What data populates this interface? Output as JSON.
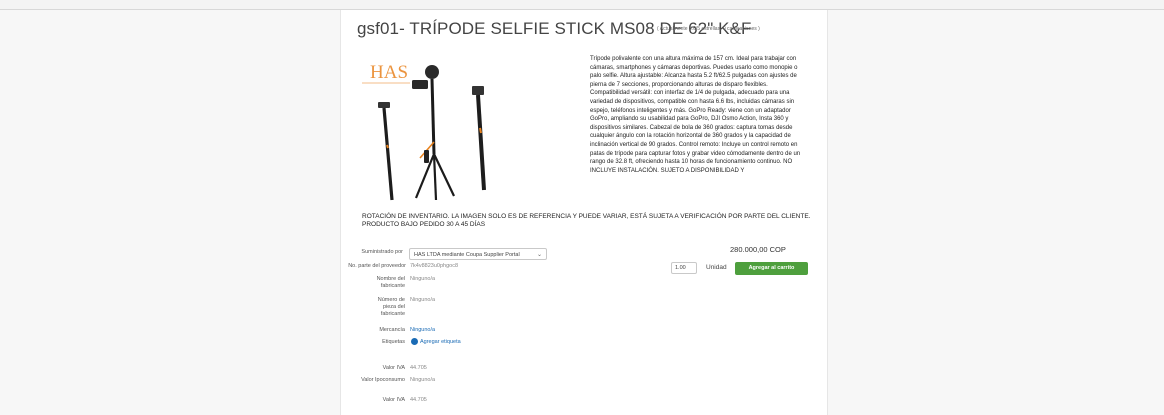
{
  "product": {
    "title": "gsf01- TRÍPODE SELFIE STICK MS08 DE 62\" K&F",
    "rating_text": "( Actualmente 0.0/5 estrellas. 0 calificaciones )",
    "logo_text": "HAS",
    "description": "Trípode polivalente con una altura máxima de 157 cm. Ideal para trabajar con cámaras, smartphones y cámaras deportivas. Puedes usarlo como monopie o palo selfie. Altura ajustable: Alcanza hasta 5.2 ft/62.5 pulgadas con ajustes de pierna de 7 secciones, proporcionando alturas de disparo flexibles. Compatibilidad versátil: con interfaz de 1/4 de pulgada, adecuado para una variedad de dispositivos, compatible con hasta 6.6 lbs, incluidas cámaras sin espejo, teléfonos inteligentes y más. GoPro Ready: viene con un adaptador GoPro, ampliando su usabilidad para GoPro, DJI Osmo Action, Insta 360 y dispositivos similares. Cabezal de bola de 360 grados: captura tomas desde cualquier ángulo con la rotación horizontal de 360 grados y la capacidad de inclinación vertical de 90 grados. Control remoto: Incluye un control remoto en patas de trípode para capturar fotos y grabar video cómodamente dentro de un rango de 32.8 ft, ofreciendo hasta 10 horas de funcionamiento continuo. NO INCLUYE INSTALACIÓN. SUJETO A DISPONIBILIDAD Y",
    "notice": "ROTACIÓN DE INVENTARIO. LA IMAGEN SOLO ES DE REFERENCIA Y PUEDE VARIAR, ESTÁ SUJETA A VERIFICACIÓN POR PARTE DEL CLIENTE. PRODUCTO BAJO PEDIDO 30 A 45 DÍAS"
  },
  "fields": {
    "supplier_label": "Suministrado por",
    "supplier_value": "HAS LTDA mediante Coupa Supplier Portal",
    "part_label": "No. parte del proveedor",
    "part_value": "7k4v8823u0phgoc8",
    "manufacturer_label": "Nombre del fabricante",
    "manufacturer_value": "Ninguno/a",
    "mfr_part_label": "Número de pieza del fabricante",
    "mfr_part_value": "Ninguno/a",
    "brand_label": "Mercancía",
    "brand_value": "Ninguno/a",
    "tags_label": "Etiquetas",
    "tags_action": "Agregar etiqueta",
    "iva_label": "Valor IVA",
    "iva_value": "44.705",
    "ipoconsumo_label": "Valor Ipoconsumo",
    "ipoconsumo_value": "Ninguno/a",
    "iva2_label": "Valor IVA",
    "iva2_value": "44.705"
  },
  "purchase": {
    "price": "280.000,00 COP",
    "quantity": "1.00",
    "unit_label": "Unidad",
    "add_to_cart": "Agregar al carrito"
  },
  "colors": {
    "accent_green": "#4e9f3d",
    "link_blue": "#1a6bb5",
    "tripod_orange": "#e8821e"
  }
}
